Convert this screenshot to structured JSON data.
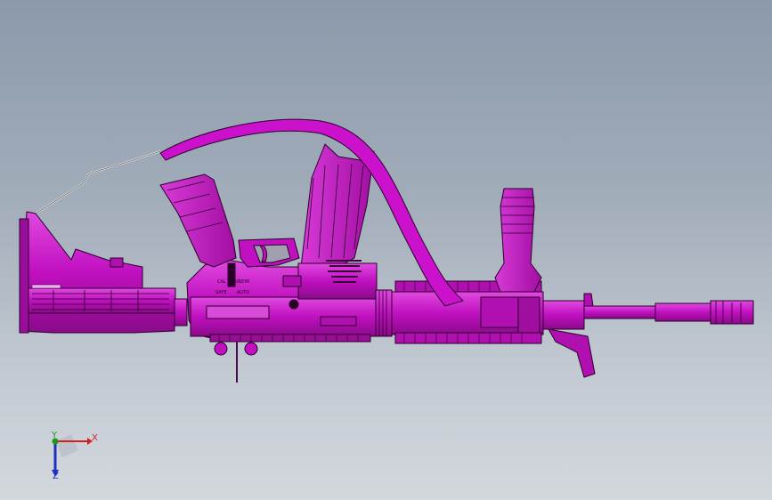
{
  "viewport": {
    "background_top": "#8b99aa",
    "background_bottom": "#d3d8dd"
  },
  "model": {
    "part_color": "#cc11cc",
    "edge_color": "#2a002a",
    "receiver_markings": [
      "CAL",
      "5.56",
      "SAFE",
      "SEMI",
      "AUTO"
    ]
  },
  "triad": {
    "x_label": "X",
    "y_label": "Y",
    "z_label": "Z",
    "x_color": "#d02020",
    "y_color": "#1a9a1a",
    "z_color": "#2030c0"
  }
}
